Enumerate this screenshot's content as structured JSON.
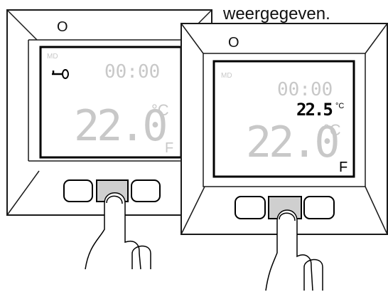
{
  "caption": "weergegeven.",
  "back_unit": {
    "power_symbol": "O",
    "mode_label": "MD",
    "key_symbol": "key-icon",
    "time": "00:00",
    "temperature": "22.0",
    "unit": "°C",
    "fan_label": "F"
  },
  "front_unit": {
    "power_symbol": "O",
    "mode_label": "MD",
    "time": "00:00",
    "setpoint": "22.5",
    "setpoint_unit": "°C",
    "temperature": "22.0",
    "unit": "°C",
    "fan_label": "F"
  },
  "colors": {
    "outline": "#1a1a1a",
    "dim_segment": "#c8c8c8",
    "active_segment": "#000000",
    "pressed_button": "#cfcfcf"
  }
}
